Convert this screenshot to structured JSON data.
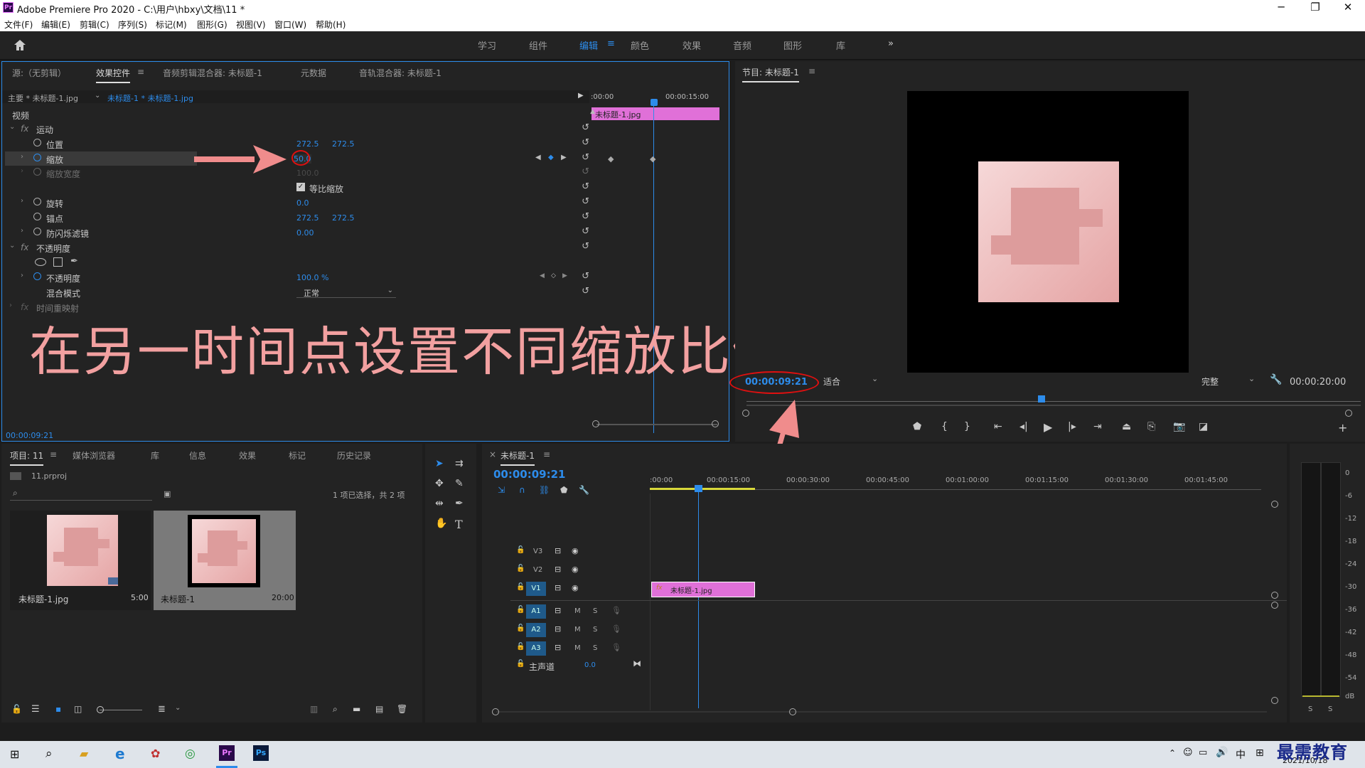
{
  "window": {
    "title": "Adobe Premiere Pro 2020 - C:\\用户\\hbxy\\文档\\11 *",
    "logo": "Pr",
    "minimize": "─",
    "maximize": "❐",
    "close": "✕"
  },
  "menu": [
    "文件(F)",
    "编辑(E)",
    "剪辑(C)",
    "序列(S)",
    "标记(M)",
    "图形(G)",
    "视图(V)",
    "窗口(W)",
    "帮助(H)"
  ],
  "workspaces": [
    "学习",
    "组件",
    "编辑",
    "颜色",
    "效果",
    "音频",
    "图形",
    "库"
  ],
  "active_workspace": "编辑",
  "effect_panel": {
    "tabs": [
      "源:（无剪辑）",
      "效果控件",
      "音频剪辑混合器: 未标题-1",
      "元数据",
      "音轨混合器: 未标题-1"
    ],
    "master_clip": "主要 * 未标题-1.jpg",
    "seq_clip": "未标题-1 * 未标题-1.jpg",
    "ruler_start": ":00:00",
    "ruler_mid": "00:00:15:00",
    "clip_label": "未标题-1.jpg",
    "section_video": "视频",
    "motion": "运动",
    "position_label": "位置",
    "position_x": "272.5",
    "position_y": "272.5",
    "scale_label": "缩放",
    "scale_value": "50.0",
    "scale_width_label": "缩放宽度",
    "scale_width_value": "100.0",
    "uniform_scale": "等比缩放",
    "rotation_label": "旋转",
    "rotation_value": "0.0",
    "anchor_label": "锚点",
    "anchor_x": "272.5",
    "anchor_y": "272.5",
    "flicker_label": "防闪烁滤镜",
    "flicker_value": "0.00",
    "opacity_section": "不透明度",
    "opacity_label": "不透明度",
    "opacity_value": "100.0 %",
    "blend_label": "混合模式",
    "blend_value": "正常",
    "time_remap": "时间重映射",
    "timecode": "00:00:09:21"
  },
  "annotation": "在另一时间点设置不同缩放比例",
  "program": {
    "title": "节目: 未标题-1",
    "timecode": "00:00:09:21",
    "fit": "适合",
    "quality": "完整",
    "duration": "00:00:20:00"
  },
  "project": {
    "tabs": [
      "项目: 11",
      "媒体浏览器",
      "库",
      "信息",
      "效果",
      "标记",
      "历史记录"
    ],
    "file": "11.prproj",
    "selection": "1 项已选择，共 2 项",
    "items": [
      {
        "name": "未标题-1.jpg",
        "duration": "5:00"
      },
      {
        "name": "未标题-1",
        "duration": "20:00"
      }
    ]
  },
  "timeline": {
    "tab": "未标题-1",
    "timecode": "00:00:09:21",
    "ruler": [
      ":00:00",
      "00:00:15:00",
      "00:00:30:00",
      "00:00:45:00",
      "00:01:00:00",
      "00:01:15:00",
      "00:01:30:00",
      "00:01:45:00"
    ],
    "video_tracks": [
      "V3",
      "V2",
      "V1"
    ],
    "audio_tracks": [
      "A1",
      "A2",
      "A3"
    ],
    "master": "主声道",
    "master_value": "0.0",
    "clip": "未标题-1.jpg",
    "fx": "fx",
    "m": "M",
    "s": "S"
  },
  "meter": {
    "scale": [
      "0",
      "-6",
      "-12",
      "-18",
      "-24",
      "-30",
      "-36",
      "-42",
      "-48",
      "-54",
      "dB"
    ],
    "s_labels": [
      "S",
      "S"
    ]
  },
  "taskbar": {
    "ime": "中",
    "date": "2021/10/18",
    "watermark": "最需教育"
  },
  "colors": {
    "accent": "#2d8ceb",
    "clip_pink": "#e070d8",
    "annotation": "#f2a0a0",
    "keyframe_arrow": "#f08c8c"
  }
}
